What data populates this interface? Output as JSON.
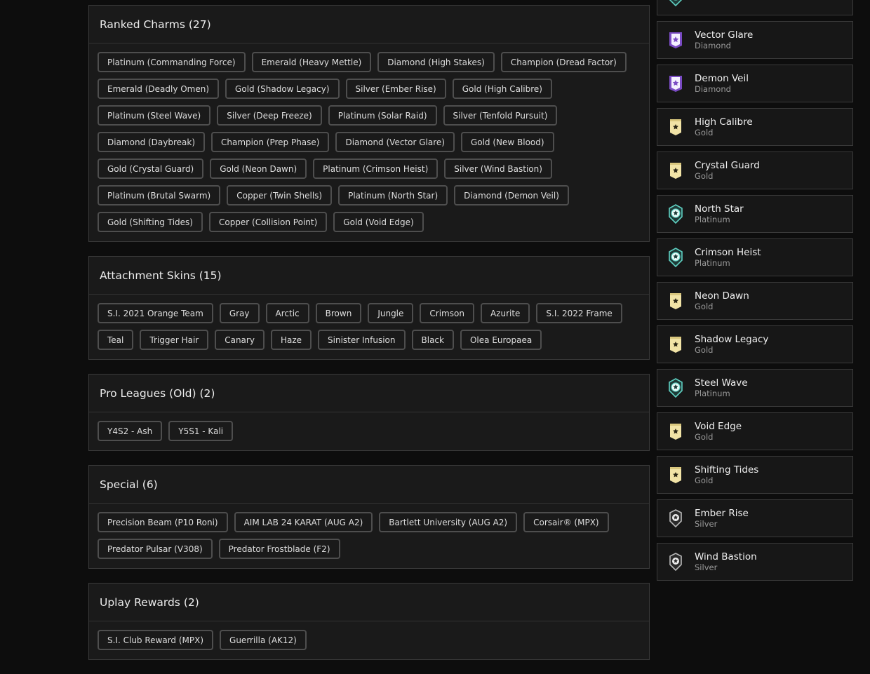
{
  "sections": [
    {
      "id": "ranked-charms",
      "title": "Ranked Charms (27)",
      "items": [
        "Platinum (Commanding Force)",
        "Emerald (Heavy Mettle)",
        "Diamond (High Stakes)",
        "Champion (Dread Factor)",
        "Emerald (Deadly Omen)",
        "Gold (Shadow Legacy)",
        "Silver (Ember Rise)",
        "Gold (High Calibre)",
        "Platinum (Steel Wave)",
        "Silver (Deep Freeze)",
        "Platinum (Solar Raid)",
        "Silver (Tenfold Pursuit)",
        "Diamond (Daybreak)",
        "Champion (Prep Phase)",
        "Diamond (Vector Glare)",
        "Gold (New Blood)",
        "Gold (Crystal Guard)",
        "Gold (Neon Dawn)",
        "Platinum (Crimson Heist)",
        "Silver (Wind Bastion)",
        "Platinum (Brutal Swarm)",
        "Copper (Twin Shells)",
        "Platinum (North Star)",
        "Diamond (Demon Veil)",
        "Gold (Shifting Tides)",
        "Copper (Collision Point)",
        "Gold (Void Edge)"
      ]
    },
    {
      "id": "attachment-skins",
      "title": "Attachment Skins (15)",
      "items": [
        "S.I. 2021 Orange Team",
        "Gray",
        "Arctic",
        "Brown",
        "Jungle",
        "Crimson",
        "Azurite",
        "S.I. 2022 Frame",
        "Teal",
        "Trigger Hair",
        "Canary",
        "Haze",
        "Sinister Infusion",
        "Black",
        "Olea Europaea"
      ]
    },
    {
      "id": "pro-leagues",
      "title": "Pro Leagues (Old) (2)",
      "items": [
        "Y4S2 - Ash",
        "Y5S1 - Kali"
      ]
    },
    {
      "id": "special",
      "title": "Special (6)",
      "items": [
        "Precision Beam (P10 Roni)",
        "AIM LAB 24 KARAT (AUG A2)",
        "Bartlett University (AUG A2)",
        "Corsair® (MPX)",
        "Predator Pulsar (V308)",
        "Predator Frostblade (F2)"
      ]
    },
    {
      "id": "uplay-rewards",
      "title": "Uplay Rewards (2)",
      "items": [
        "S.I. Club Reward (MPX)",
        "Guerrilla (AK12)"
      ]
    }
  ],
  "charm_list": [
    {
      "name": "",
      "rank": "Platinum",
      "icon": "platinum-charm-icon"
    },
    {
      "name": "Vector Glare",
      "rank": "Diamond",
      "icon": "diamond-charm-icon"
    },
    {
      "name": "Demon Veil",
      "rank": "Diamond",
      "icon": "diamond-charm-icon"
    },
    {
      "name": "High Calibre",
      "rank": "Gold",
      "icon": "gold-charm-icon"
    },
    {
      "name": "Crystal Guard",
      "rank": "Gold",
      "icon": "gold-charm-icon"
    },
    {
      "name": "North Star",
      "rank": "Platinum",
      "icon": "platinum-charm-icon"
    },
    {
      "name": "Crimson Heist",
      "rank": "Platinum",
      "icon": "platinum-charm-icon"
    },
    {
      "name": "Neon Dawn",
      "rank": "Gold",
      "icon": "gold-charm-icon"
    },
    {
      "name": "Shadow Legacy",
      "rank": "Gold",
      "icon": "gold-charm-icon"
    },
    {
      "name": "Steel Wave",
      "rank": "Platinum",
      "icon": "platinum-charm-icon"
    },
    {
      "name": "Void Edge",
      "rank": "Gold",
      "icon": "gold-charm-icon"
    },
    {
      "name": "Shifting Tides",
      "rank": "Gold",
      "icon": "gold-charm-icon"
    },
    {
      "name": "Ember Rise",
      "rank": "Silver",
      "icon": "silver-charm-icon"
    },
    {
      "name": "Wind Bastion",
      "rank": "Silver",
      "icon": "silver-charm-icon"
    }
  ],
  "colors": {
    "background": "#0d0d0d",
    "card": "#1a1a1a",
    "border": "#3a3a3a",
    "diamond": "#7a4bc4",
    "gold": "#f1e3a6",
    "platinum": "#5fd0c2",
    "silver": "#b8b8b8"
  }
}
